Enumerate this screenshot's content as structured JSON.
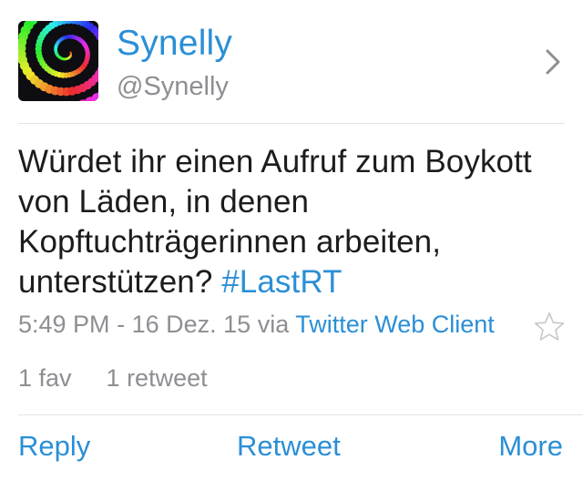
{
  "user": {
    "display_name": "Synelly",
    "handle": "@Synelly",
    "avatar_icon": "rainbow-spiral-beads-avatar"
  },
  "tweet": {
    "text_line1": "Würdet ihr einen Aufruf zum Boykott",
    "text_line2": "von Läden, in denen",
    "text_line3": "Kopftuchträgerinnen arbeiten,",
    "text_line4_prefix": "unterstützen? ",
    "hashtag": "#LastRT",
    "time": "5:49 PM",
    "separator": "-",
    "date": "16 Dez. 15",
    "via": "via",
    "client": "Twitter Web Client"
  },
  "stats": {
    "favs": "1 fav",
    "retweets": "1 retweet"
  },
  "actions": {
    "reply": "Reply",
    "retweet": "Retweet",
    "more": "More"
  },
  "colors": {
    "link": "#2b8fd6",
    "secondary": "#8e8e93",
    "divider": "#e3e3e6"
  },
  "icons": {
    "chevron": "chevron-right-icon",
    "favorite": "star-outline-icon"
  }
}
